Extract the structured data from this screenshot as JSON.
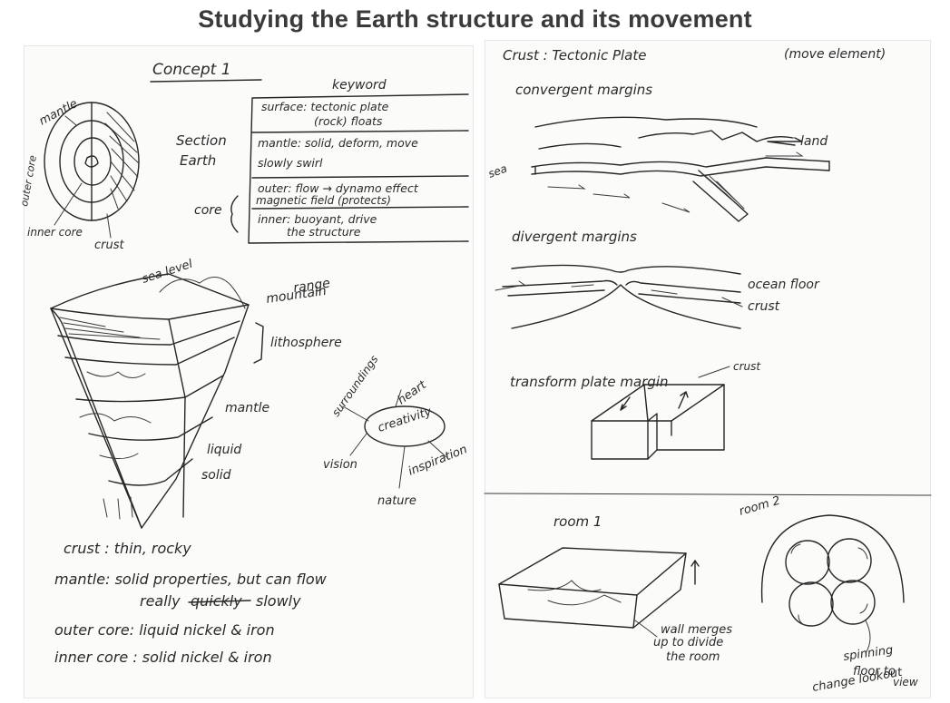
{
  "title": "Studying the Earth structure and its movement",
  "left_page": {
    "concept_label": "Concept 1",
    "section_label": "Section",
    "earth_label": "Earth",
    "earth_labels": {
      "mantle": "mantle",
      "outer_core": "outer core",
      "inner_core": "inner core",
      "crust": "crust"
    },
    "keyword_header": "keyword",
    "keywords": {
      "surface_line1": "surface: tectonic plate",
      "surface_line2": "(rock) floats",
      "mantle_line1": "mantle: solid, deform, move",
      "mantle_line2": "slowly swirl",
      "core_label": "core",
      "outer_line1": "outer: flow → dynamo effect",
      "outer_line2": "magnetic field (protects)",
      "inner_line1": "inner: buoyant, drive",
      "inner_line2": "the structure"
    },
    "wedge_labels": {
      "sea_level": "sea level",
      "mountain_range_1": "mountain",
      "mountain_range_2": "range",
      "lithosphere": "lithosphere",
      "mantle": "mantle",
      "liquid": "liquid",
      "solid": "solid"
    },
    "mindmap": {
      "center": "creativity",
      "surroundings": "surroundings",
      "heart": "heart",
      "vision": "vision",
      "inspiration": "inspiration",
      "nature": "nature"
    },
    "notes": {
      "crust": "crust : thin, rocky",
      "mantle_a": "mantle: solid properties, but can flow",
      "mantle_b_prefix": "really",
      "mantle_b_struck": "quickly",
      "mantle_b_suffix": "slowly",
      "outer_core": "outer core: liquid nickel & iron",
      "inner_core": "inner core : solid nickel & iron"
    }
  },
  "right_page": {
    "heading": "Crust : Tectonic Plate",
    "heading_note": "(move element)",
    "convergent": {
      "title": "convergent margins",
      "land": "land",
      "sea": "sea"
    },
    "divergent": {
      "title": "divergent margins",
      "ocean_floor": "ocean floor",
      "crust": "crust"
    },
    "transform": {
      "title": "transform plate margin",
      "crust": "crust"
    },
    "room1": {
      "title": "room 1",
      "note_1": "wall merges",
      "note_2": "up to divide",
      "note_3": "the room"
    },
    "room2": {
      "title": "room 2",
      "note_1": "spinning",
      "note_2": "floor to",
      "note_3": "change lookout",
      "note_4": "view"
    }
  }
}
